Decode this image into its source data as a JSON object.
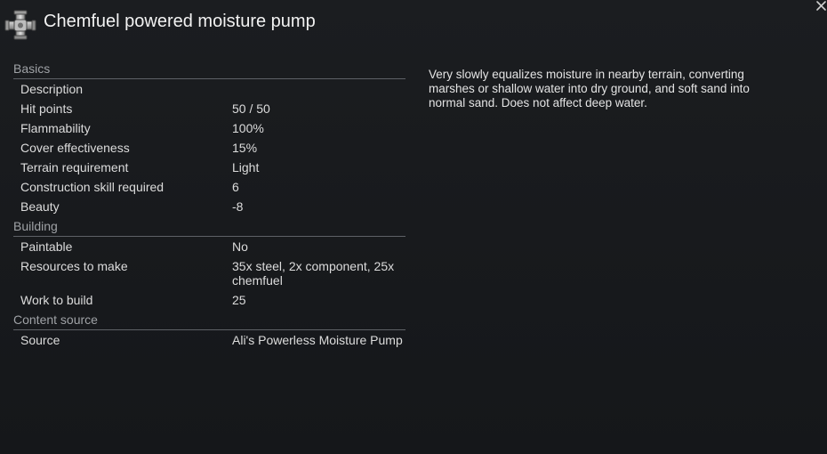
{
  "window": {
    "title": "Chemfuel powered moisture pump",
    "icon": "moisture-pump-icon",
    "close_icon": "close-icon"
  },
  "stats": {
    "basics": {
      "header": "Basics",
      "rows": [
        {
          "label": "Description",
          "value": ""
        },
        {
          "label": "Hit points",
          "value": "50 / 50"
        },
        {
          "label": "Flammability",
          "value": "100%"
        },
        {
          "label": "Cover effectiveness",
          "value": "15%"
        },
        {
          "label": "Terrain requirement",
          "value": "Light"
        },
        {
          "label": "Construction skill required",
          "value": "6"
        },
        {
          "label": "Beauty",
          "value": "-8"
        }
      ]
    },
    "building": {
      "header": "Building",
      "rows": [
        {
          "label": "Paintable",
          "value": "No"
        },
        {
          "label": "Resources to make",
          "value": "35x steel, 2x component, 25x chemfuel"
        },
        {
          "label": "Work to build",
          "value": "25"
        }
      ]
    },
    "content_source": {
      "header": "Content source",
      "rows": [
        {
          "label": "Source",
          "value": "Ali's Powerless Moisture Pump"
        }
      ]
    }
  },
  "description": "Very slowly equalizes moisture in nearby terrain, converting marshes or shallow water into dry ground, and soft sand into normal sand. Does not affect deep water.",
  "colors": {
    "background": "#16181b",
    "category_text": "#9fa2a6",
    "text": "#dcdcdc",
    "divider": "#5e6166"
  }
}
